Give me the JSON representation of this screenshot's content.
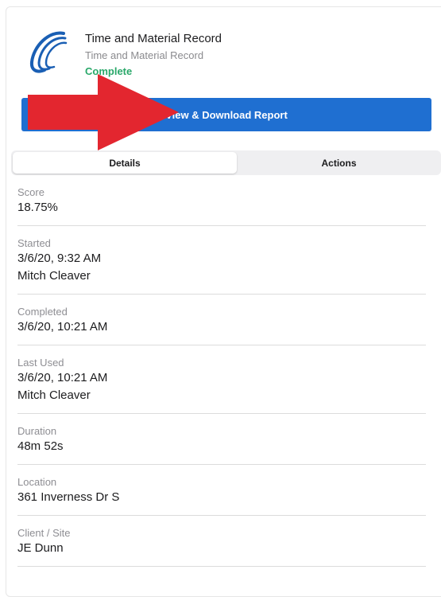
{
  "record": {
    "title": "Time and Material Record",
    "subtitle": "Time and Material Record",
    "status": "Complete",
    "status_color": "#2aa86a",
    "logo_icon": "company-swoosh-logo",
    "logo_color": "#1a5fb4"
  },
  "report_button": {
    "label": "View & Download Report",
    "color": "#1f6fd1"
  },
  "annotation": {
    "icon": "red-arrow",
    "color": "#e3262f"
  },
  "tabs": [
    {
      "label": "Details",
      "selected": true
    },
    {
      "label": "Actions",
      "selected": false
    }
  ],
  "details": [
    {
      "label": "Score",
      "lines": [
        "18.75%"
      ]
    },
    {
      "label": "Started",
      "lines": [
        "3/6/20, 9:32 AM",
        "Mitch Cleaver"
      ]
    },
    {
      "label": "Completed",
      "lines": [
        "3/6/20, 10:21 AM"
      ]
    },
    {
      "label": "Last Used",
      "lines": [
        "3/6/20, 10:21 AM",
        "Mitch Cleaver"
      ]
    },
    {
      "label": "Duration",
      "lines": [
        "48m 52s"
      ]
    },
    {
      "label": "Location",
      "lines": [
        "361 Inverness Dr S"
      ]
    },
    {
      "label": "Client / Site",
      "lines": [
        "JE Dunn"
      ]
    }
  ]
}
